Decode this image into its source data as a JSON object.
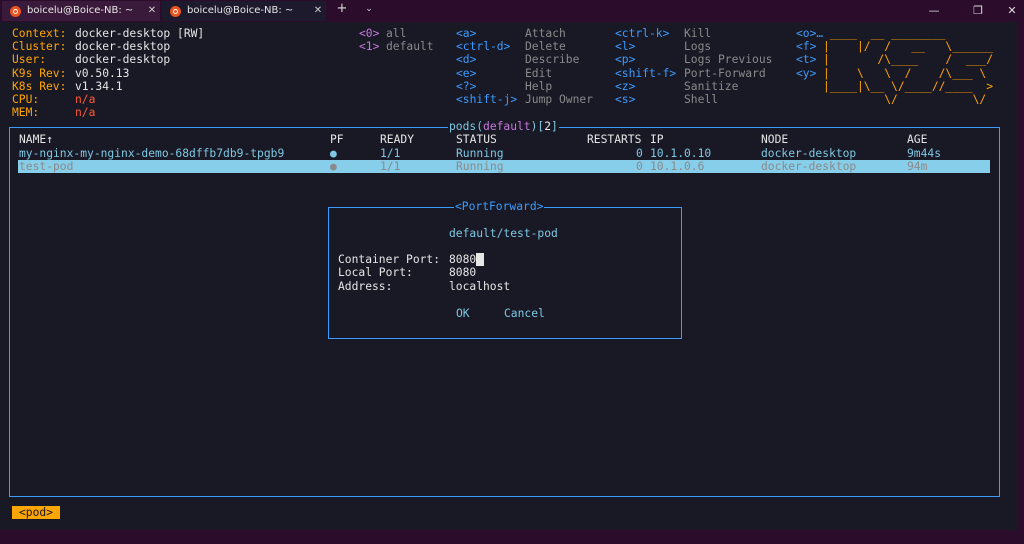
{
  "window": {
    "tabs": [
      {
        "label": "boicelu@Boice-NB: ~",
        "active": false
      },
      {
        "label": "boicelu@Boice-NB: ~",
        "active": true
      }
    ],
    "new_tab_glyph": "+",
    "tab_menu_glyph": "⌄",
    "tab_close_glyph": "✕",
    "minimize_glyph": "—",
    "maximize_glyph": "❐",
    "close_glyph": "✕",
    "accent_color": "#e95420"
  },
  "info": {
    "context_label": "Context:",
    "context_value": "docker-desktop [RW]",
    "cluster_label": "Cluster:",
    "cluster_value": "docker-desktop",
    "user_label": "User:",
    "user_value": "docker-desktop",
    "k9s_rev_label": "K9s Rev:",
    "k9s_rev_value": "v0.50.13",
    "k8s_rev_label": "K8s Rev:",
    "k8s_rev_value": "v1.34.1",
    "cpu_label": "CPU:",
    "cpu_value": "n/a",
    "mem_label": "MEM:",
    "mem_value": "n/a"
  },
  "namespaces": [
    {
      "key": "<0>",
      "label": "all"
    },
    {
      "key": "<1>",
      "label": "default"
    }
  ],
  "shortcuts_col1": [
    {
      "key": "<a>",
      "label": "Attach"
    },
    {
      "key": "<ctrl-d>",
      "label": "Delete"
    },
    {
      "key": "<d>",
      "label": "Describe"
    },
    {
      "key": "<e>",
      "label": "Edit"
    },
    {
      "key": "<?>",
      "label": "Help"
    },
    {
      "key": "<shift-j>",
      "label": "Jump Owner"
    }
  ],
  "shortcuts_col2": [
    {
      "key": "<ctrl-k>",
      "label": "Kill"
    },
    {
      "key": "<l>",
      "label": "Logs"
    },
    {
      "key": "<p>",
      "label": "Logs Previous"
    },
    {
      "key": "<shift-f>",
      "label": "Port-Forward"
    },
    {
      "key": "<z>",
      "label": "Sanitize"
    },
    {
      "key": "<s>",
      "label": "Shell"
    }
  ],
  "shortcuts_col3": [
    {
      "key": "<o>…"
    },
    {
      "key": "<f>"
    },
    {
      "key": "<t>"
    },
    {
      "key": "<y>"
    }
  ],
  "logo_lines": [
    " ____  __ ________       ",
    "|    |/  /   __   \\______",
    "|       /\\____    /  ___/",
    "|    \\   \\  /    /\\___ \\ ",
    "|____|\\__ \\/____//____  >",
    "         \\/           \\/ "
  ],
  "table": {
    "title_prefix": "pods(",
    "title_ns": "default",
    "title_mid": ")[",
    "title_count": "2",
    "title_suffix": "]",
    "headers": {
      "name": "NAME↑",
      "pf": "PF",
      "ready": "READY",
      "status": "STATUS",
      "restarts": "RESTARTS",
      "ip": "IP",
      "node": "NODE",
      "age": "AGE"
    },
    "rows": [
      {
        "name": "my-nginx-my-nginx-demo-68dffb7db9-tpgb9",
        "pf": "●",
        "ready": "1/1",
        "status": "Running",
        "restarts": "0",
        "ip": "10.1.0.10",
        "node": "docker-desktop",
        "age": "9m44s"
      },
      {
        "name": "test-pod",
        "pf": "●",
        "ready": "1/1",
        "status": "Running",
        "restarts": "0",
        "ip": "10.1.0.6",
        "node": "docker-desktop",
        "age": "94m"
      }
    ]
  },
  "dialog": {
    "title": "<PortForward>",
    "target": "default/test-pod",
    "container_port_label": "Container Port:",
    "container_port_value": "8080",
    "local_port_label": "Local Port:",
    "local_port_value": "8080",
    "address_label": "Address:",
    "address_value": "localhost",
    "ok_label": "OK",
    "cancel_label": "Cancel"
  },
  "breadcrumb": "<pod>"
}
